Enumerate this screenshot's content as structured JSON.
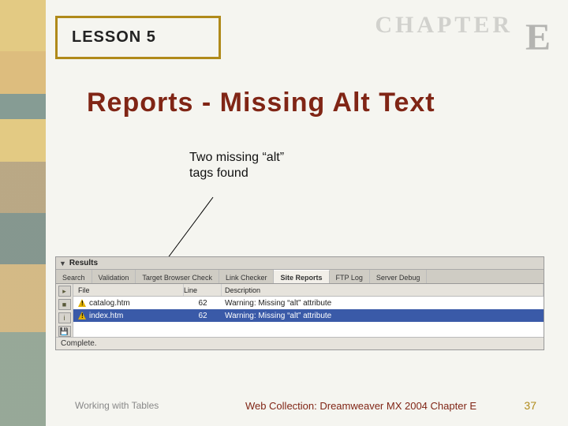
{
  "header": {
    "lesson_label": "LESSON 5",
    "chapter_word": "CHAPTER",
    "chapter_letter": "E"
  },
  "slide": {
    "title": "Reports - Missing Alt Text",
    "callout_line1": "Two missing “alt”",
    "callout_line2": "tags found"
  },
  "panel": {
    "title": "Results",
    "tabs": [
      "Search",
      "Validation",
      "Target Browser Check",
      "Link Checker",
      "Site Reports",
      "FTP Log",
      "Server Debug"
    ],
    "active_tab_index": 4,
    "columns": {
      "file": "File",
      "line": "Line",
      "desc": "Description"
    },
    "rows": [
      {
        "file": "catalog.htm",
        "line": "62",
        "desc": "Warning: Missing “alt” attribute",
        "selected": false
      },
      {
        "file": "index.htm",
        "line": "62",
        "desc": "Warning: Missing “alt” attribute",
        "selected": true
      }
    ],
    "status": "Complete."
  },
  "footer": {
    "left": "Working with Tables",
    "center": "Web Collection: Dreamweaver MX 2004 Chapter E",
    "page": "37"
  }
}
